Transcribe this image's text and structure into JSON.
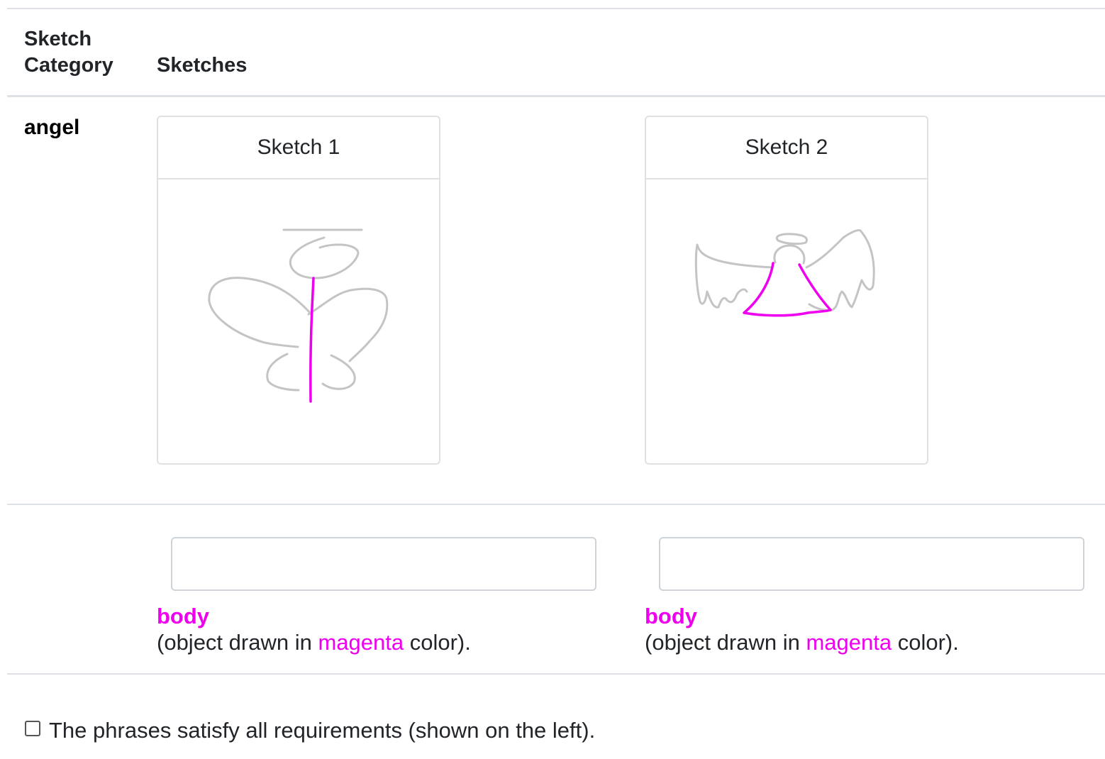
{
  "table": {
    "headers": {
      "category_line1": "Sketch",
      "category_line2": "Category",
      "sketches": "Sketches"
    },
    "category": "angel"
  },
  "sketches": [
    {
      "title": "Sketch 1",
      "highlight_color": "#ee00ee",
      "stroke_color": "#c4c4c4"
    },
    {
      "title": "Sketch 2",
      "highlight_color": "#ee00ee",
      "stroke_color": "#c4c4c4"
    }
  ],
  "annotations": [
    {
      "input_value": "",
      "part": "body",
      "desc_prefix": "(object drawn in ",
      "color_word": "magenta",
      "desc_suffix": " color)."
    },
    {
      "input_value": "",
      "part": "body",
      "desc_prefix": "(object drawn in ",
      "color_word": "magenta",
      "desc_suffix": " color)."
    }
  ],
  "confirm": {
    "label": "The phrases satisfy all requirements (shown on the left).",
    "checked": false
  }
}
